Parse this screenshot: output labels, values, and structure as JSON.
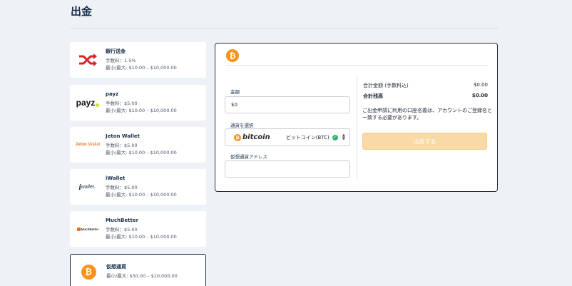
{
  "page": {
    "title": "出金"
  },
  "methods": [
    {
      "name": "銀行送金",
      "fee": "手数料：1.5%",
      "limits": "最小/最大: $10.00 – $10,000.00",
      "icon": "bank-transfer-icon"
    },
    {
      "name": "payz",
      "fee": "手数料：$5.00",
      "limits": "最小/最大: $10.00 – $10,000.00",
      "icon": "payz-logo"
    },
    {
      "name": "Jeton Wallet",
      "fee": "手数料：$5.00",
      "limits": "最小/最大: $10.00 – $10,000.00",
      "icon": "jeton-wallet-logo"
    },
    {
      "name": "iWallet",
      "fee": "手数料：$5.00",
      "limits": "最小/最大: $10.00 – $10,000.00",
      "icon": "iwallet-logo"
    },
    {
      "name": "MuchBetter",
      "fee": "手数料：$5.00",
      "limits": "最小/最大: $10.00 – $10,000.00",
      "icon": "muchbetter-logo"
    },
    {
      "name": "仮想通貨",
      "fee": "",
      "limits": "最小/最大: $50.00 – $10,000.00",
      "icon": "bitcoin-icon",
      "selected": true
    }
  ],
  "logos": {
    "payz": "payz",
    "jeton": "Jeton",
    "jeton_suffix": "Wallet",
    "iwallet": "wallet..",
    "muchbetter": "MuchBetter",
    "bitcoin_symbol": "₿",
    "bitcoin_word": "bitcoin"
  },
  "form": {
    "amount_label": "金額",
    "amount_value": "$0",
    "currency_label": "通貨を選択",
    "currency_selected": "ビットコイン(BTC)",
    "address_label": "仮想通貨アドレス",
    "address_value": ""
  },
  "summary": {
    "total_label": "合計金額 (手数料込)",
    "total_value": "$0.00",
    "balance_label": "合計残高",
    "balance_value": "$0.00",
    "notice": "ご出金申請に利用の口座名義は、アカウントのご登録名と一致する必要があります。",
    "button_label": "出金する"
  },
  "colors": {
    "bitcoin": "#f7931a",
    "navy": "#1a2f4a",
    "bank_red": "#d6262b",
    "payz_dot": "#c6e32b",
    "jeton_orange": "#f26c21",
    "button_disabled": "#f9d9a6"
  }
}
